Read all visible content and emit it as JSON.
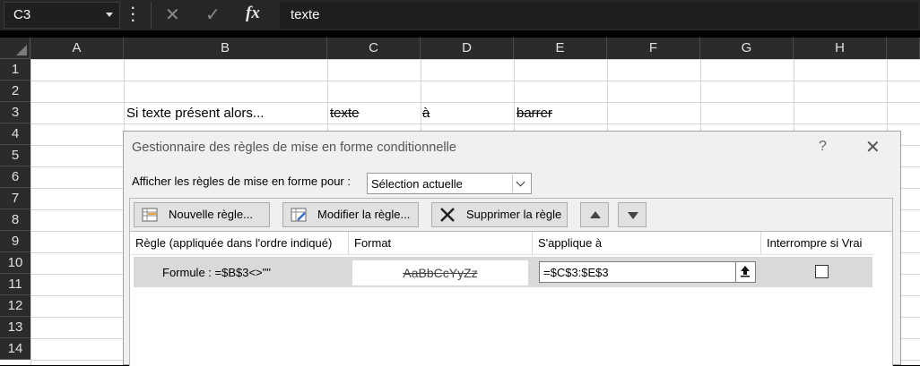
{
  "formula_bar": {
    "name_box": "C3",
    "fx_label": "fx",
    "formula": "texte"
  },
  "columns": [
    "A",
    "B",
    "C",
    "D",
    "E",
    "F",
    "G",
    "H"
  ],
  "rows": [
    "1",
    "2",
    "3",
    "4",
    "5",
    "6",
    "7",
    "8",
    "9",
    "10",
    "11",
    "12",
    "13",
    "14"
  ],
  "cells": {
    "B3": "Si texte présent alors...",
    "C3": "texte",
    "D3": "à",
    "E3": "barrer"
  },
  "dialog": {
    "title": "Gestionnaire des règles de mise en forme conditionnelle",
    "help": "?",
    "close": "✕",
    "show_rules_label": "Afficher les règles de mise en forme pour :",
    "show_rules_value": "Sélection actuelle",
    "buttons": {
      "new_rule": "Nouvelle règle...",
      "edit_rule": "Modifier la règle...",
      "delete_rule": "Supprimer la règle"
    },
    "list_headers": {
      "rule": "Règle (appliquée dans l'ordre indiqué)",
      "format": "Format",
      "applies_to": "S'applique à",
      "stop_if_true": "Interrompre si Vrai"
    },
    "rules": [
      {
        "name": "Formule : =$B$3<>\"\"",
        "preview": "AaBbCcYyZz",
        "applies_to": "=$C$3:$E$3",
        "stop_if_true": false
      }
    ]
  }
}
